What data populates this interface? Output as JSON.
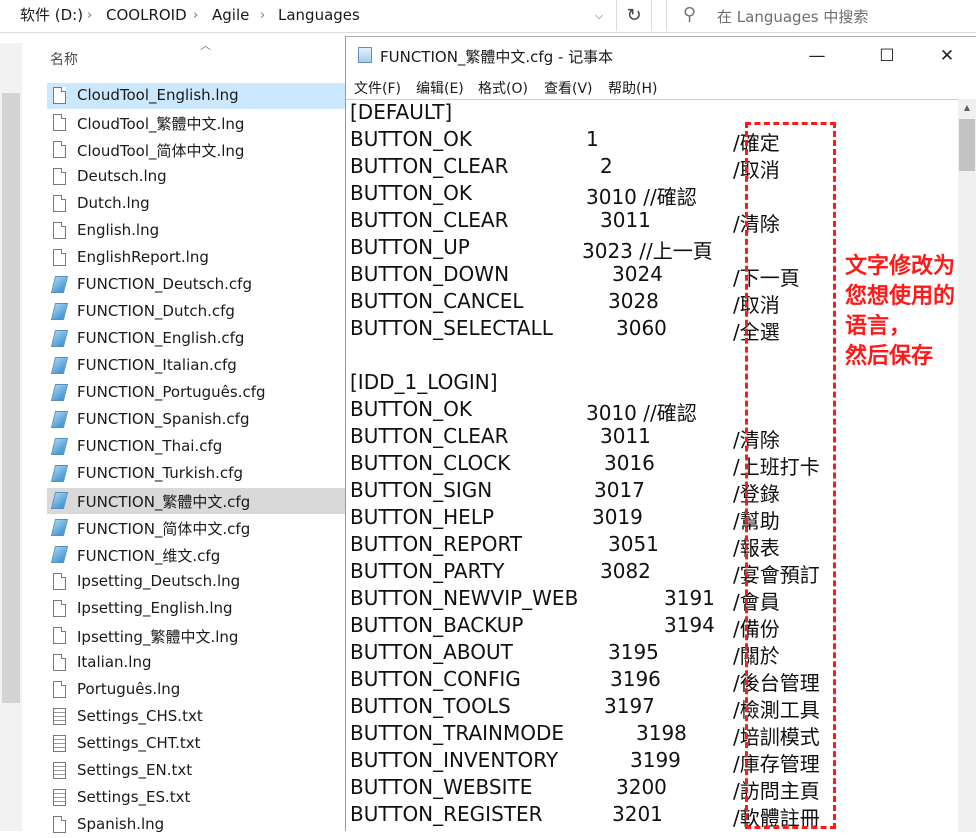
{
  "explorer": {
    "breadcrumbs": [
      "软件 (D:)",
      "COOLROID",
      "Agile",
      "Languages"
    ],
    "search_placeholder": "在 Languages 中搜索",
    "column_header": "名称",
    "files": [
      {
        "name": "CloudTool_English.lng",
        "type": "lng",
        "state": "hover"
      },
      {
        "name": "CloudTool_繁體中文.lng",
        "type": "lng"
      },
      {
        "name": "CloudTool_简体中文.lng",
        "type": "lng"
      },
      {
        "name": "Deutsch.lng",
        "type": "lng"
      },
      {
        "name": "Dutch.lng",
        "type": "lng"
      },
      {
        "name": "English.lng",
        "type": "lng"
      },
      {
        "name": "EnglishReport.lng",
        "type": "lng"
      },
      {
        "name": "FUNCTION_Deutsch.cfg",
        "type": "cfg"
      },
      {
        "name": "FUNCTION_Dutch.cfg",
        "type": "cfg"
      },
      {
        "name": "FUNCTION_English.cfg",
        "type": "cfg"
      },
      {
        "name": "FUNCTION_Italian.cfg",
        "type": "cfg"
      },
      {
        "name": "FUNCTION_Português.cfg",
        "type": "cfg"
      },
      {
        "name": "FUNCTION_Spanish.cfg",
        "type": "cfg"
      },
      {
        "name": "FUNCTION_Thai.cfg",
        "type": "cfg"
      },
      {
        "name": "FUNCTION_Turkish.cfg",
        "type": "cfg"
      },
      {
        "name": "FUNCTION_繁體中文.cfg",
        "type": "cfg",
        "state": "selected"
      },
      {
        "name": "FUNCTION_简体中文.cfg",
        "type": "cfg"
      },
      {
        "name": "FUNCTION_维文.cfg",
        "type": "cfg"
      },
      {
        "name": "Ipsetting_Deutsch.lng",
        "type": "lng"
      },
      {
        "name": "Ipsetting_English.lng",
        "type": "lng"
      },
      {
        "name": "Ipsetting_繁體中文.lng",
        "type": "lng"
      },
      {
        "name": "Italian.lng",
        "type": "lng"
      },
      {
        "name": "Português.lng",
        "type": "lng"
      },
      {
        "name": "Settings_CHS.txt",
        "type": "txt"
      },
      {
        "name": "Settings_CHT.txt",
        "type": "txt"
      },
      {
        "name": "Settings_EN.txt",
        "type": "txt"
      },
      {
        "name": "Settings_ES.txt",
        "type": "txt"
      },
      {
        "name": "Spanish.lng",
        "type": "lng"
      }
    ]
  },
  "notepad": {
    "title": "FUNCTION_繁體中文.cfg - 记事本",
    "window_buttons": {
      "minimize": "—",
      "maximize": "☐",
      "close": "✕"
    },
    "menus": [
      "文件(F)",
      "编辑(E)",
      "格式(O)",
      "查看(V)",
      "帮助(H)"
    ],
    "lines": [
      {
        "key": "[DEFAULT]",
        "num": "",
        "comment": ""
      },
      {
        "key": "BUTTON_OK",
        "num": "1",
        "comment": "/確定"
      },
      {
        "key": "BUTTON_CLEAR",
        "num": "2",
        "comment": "/取消"
      },
      {
        "key": "BUTTON_OK",
        "num": "3010 //確認",
        "comment": ""
      },
      {
        "key": "BUTTON_CLEAR",
        "num": "3011",
        "comment": "/清除"
      },
      {
        "key": "BUTTON_UP",
        "num": "3023 //上一頁",
        "comment": ""
      },
      {
        "key": "BUTTON_DOWN",
        "num": "3024",
        "comment": "/下一頁"
      },
      {
        "key": "BUTTON_CANCEL",
        "num": "3028",
        "comment": "/取消"
      },
      {
        "key": "BUTTON_SELECTALL",
        "num": "3060",
        "comment": "/全選"
      },
      {
        "key": "",
        "num": "",
        "comment": ""
      },
      {
        "key": "[IDD_1_LOGIN]",
        "num": "",
        "comment": ""
      },
      {
        "key": "BUTTON_OK",
        "num": "3010 //確認",
        "comment": ""
      },
      {
        "key": "BUTTON_CLEAR",
        "num": "3011",
        "comment": "/清除"
      },
      {
        "key": "BUTTON_CLOCK",
        "num": "3016",
        "comment": "/上班打卡"
      },
      {
        "key": "BUTTON_SIGN",
        "num": "3017",
        "comment": "/登錄"
      },
      {
        "key": "BUTTON_HELP",
        "num": "3019",
        "comment": "/幫助"
      },
      {
        "key": "BUTTON_REPORT",
        "num": "3051",
        "comment": "/報表"
      },
      {
        "key": "BUTTON_PARTY",
        "num": "3082",
        "comment": "/宴會預訂"
      },
      {
        "key": "BUTTON_NEWVIP_WEB",
        "num": "3191",
        "comment": "/會員"
      },
      {
        "key": "BUTTON_BACKUP",
        "num": "3194",
        "comment": "/備份"
      },
      {
        "key": "BUTTON_ABOUT",
        "num": "3195",
        "comment": "/關於"
      },
      {
        "key": "BUTTON_CONFIG",
        "num": "3196",
        "comment": "/後台管理"
      },
      {
        "key": "BUTTON_TOOLS",
        "num": "3197",
        "comment": "/檢測工具"
      },
      {
        "key": "BUTTON_TRAINMODE",
        "num": "3198",
        "comment": "/培訓模式"
      },
      {
        "key": "BUTTON_INVENTORY",
        "num": "3199",
        "comment": "/庫存管理"
      },
      {
        "key": "BUTTON_WEBSITE",
        "num": "3200",
        "comment": "/訪問主頁"
      },
      {
        "key": "BUTTON_REGISTER",
        "num": "3201",
        "comment": "/軟體註冊"
      }
    ]
  },
  "annotation": {
    "color": "#ff1a1a",
    "note_lines": [
      "文字修改为",
      "您想使用的",
      "语言，",
      "然后保存"
    ]
  }
}
